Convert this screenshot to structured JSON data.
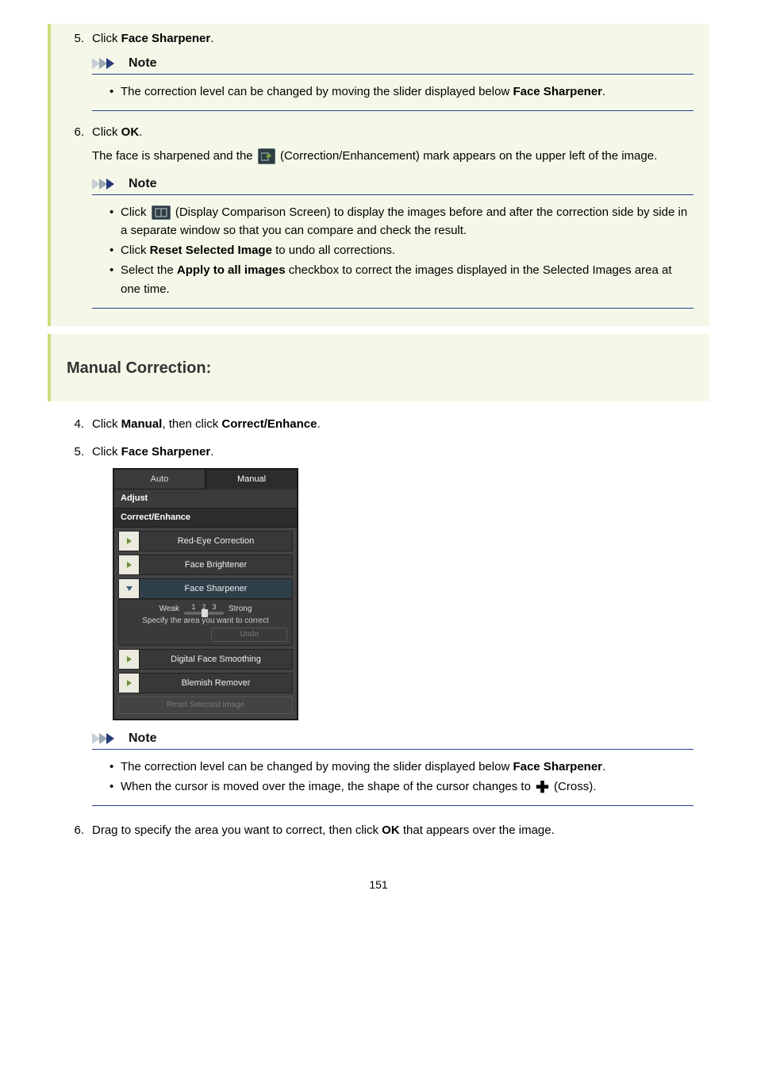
{
  "steps_a": {
    "s5": {
      "num": "5.",
      "pre": "Click ",
      "bold": "Face Sharpener",
      "post": "."
    },
    "s5_note": {
      "header": "Note",
      "items": [
        {
          "pre": "The correction level can be changed by moving the slider displayed below ",
          "bold": "Face Sharpener",
          "post": "."
        }
      ]
    },
    "s6": {
      "num": "6.",
      "pre": "Click ",
      "bold": "OK",
      "post": "."
    },
    "s6_para": {
      "pre": "The face is sharpened and the ",
      "post": " (Correction/Enhancement) mark appears on the upper left of the image."
    },
    "s6_note": {
      "header": "Note",
      "items": [
        {
          "pre": "Click ",
          "post_after_icon": " (Display Comparison Screen) to display the images before and after the correction side by side in a separate window so that you can compare and check the result."
        },
        {
          "pre": "Click ",
          "bold": "Reset Selected Image",
          "post": " to undo all corrections."
        },
        {
          "pre": "Select the ",
          "bold": "Apply to all images",
          "post": " checkbox to correct the images displayed in the Selected Images area at one time."
        }
      ]
    }
  },
  "section_title": "Manual Correction:",
  "steps_b": {
    "s4": {
      "num": "4.",
      "pre": "Click ",
      "bold1": "Manual",
      "mid": ", then click ",
      "bold2": "Correct/Enhance",
      "post": "."
    },
    "s5": {
      "num": "5.",
      "pre": "Click ",
      "bold": "Face Sharpener",
      "post": "."
    },
    "panel": {
      "tab_auto": "Auto",
      "tab_manual": "Manual",
      "sub_adjust": "Adjust",
      "sub_correct": "Correct/Enhance",
      "rows": {
        "redeye": "Red-Eye Correction",
        "brightener": "Face Brightener",
        "sharpener": "Face Sharpener",
        "smoothing": "Digital Face Smoothing",
        "blemish": "Blemish Remover"
      },
      "slider": {
        "weak": "Weak",
        "strong": "Strong",
        "n1": "1",
        "n2": "2",
        "n3": "3",
        "msg": "Specify the area you want to correct",
        "undo": "Undo"
      },
      "reset": "Reset Selected Image"
    },
    "s5_note": {
      "header": "Note",
      "items": [
        {
          "pre": "The correction level can be changed by moving the slider displayed below ",
          "bold": "Face Sharpener",
          "post": "."
        },
        {
          "pre": "When the cursor is moved over the image, the shape of the cursor changes to ",
          "post_after_icon": " (Cross)."
        }
      ]
    },
    "s6": {
      "num": "6.",
      "pre": "Drag to specify the area you want to correct, then click ",
      "bold": "OK",
      "post": " that appears over the image."
    }
  },
  "pagenum": "151"
}
